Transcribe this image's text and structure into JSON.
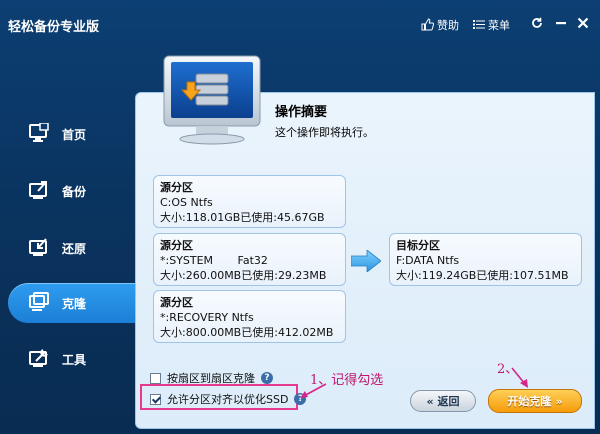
{
  "app": {
    "title": "轻松备份专业版"
  },
  "toolbar": {
    "sponsor_label": "赞助",
    "menu_label": "菜单"
  },
  "sidebar": {
    "items": [
      {
        "label": "首页"
      },
      {
        "label": "备份"
      },
      {
        "label": "还原"
      },
      {
        "label": "克隆",
        "active": true
      },
      {
        "label": "工具"
      }
    ]
  },
  "summary": {
    "title": "操作摘要",
    "description": "这个操作即将执行。"
  },
  "sources": [
    {
      "title": "源分区",
      "name": "C:OS Ntfs",
      "size": "大小:118.01GB已使用:45.67GB"
    },
    {
      "title": "源分区",
      "name": "*:SYSTEM       Fat32",
      "size": "大小:260.00MB已使用:29.23MB"
    },
    {
      "title": "源分区",
      "name": "*:RECOVERY Ntfs",
      "size": "大小:800.00MB已使用:412.02MB"
    }
  ],
  "target": {
    "title": "目标分区",
    "name": "F:DATA Ntfs",
    "size": "大小:119.24GB已使用:107.51MB"
  },
  "options": {
    "sector_clone": {
      "label": "按扇区到扇区克隆",
      "checked": false
    },
    "ssd_align": {
      "label": "允许分区对齐以优化SSD",
      "checked": true
    }
  },
  "annotations": {
    "step1": "1、记得勾选",
    "step2": "2、"
  },
  "buttons": {
    "back_label": "返回",
    "start_label": "开始克隆"
  },
  "colors": {
    "accent": "#1b7fd6",
    "highlight": "#e6398f",
    "start_button": "#f59c0b"
  }
}
